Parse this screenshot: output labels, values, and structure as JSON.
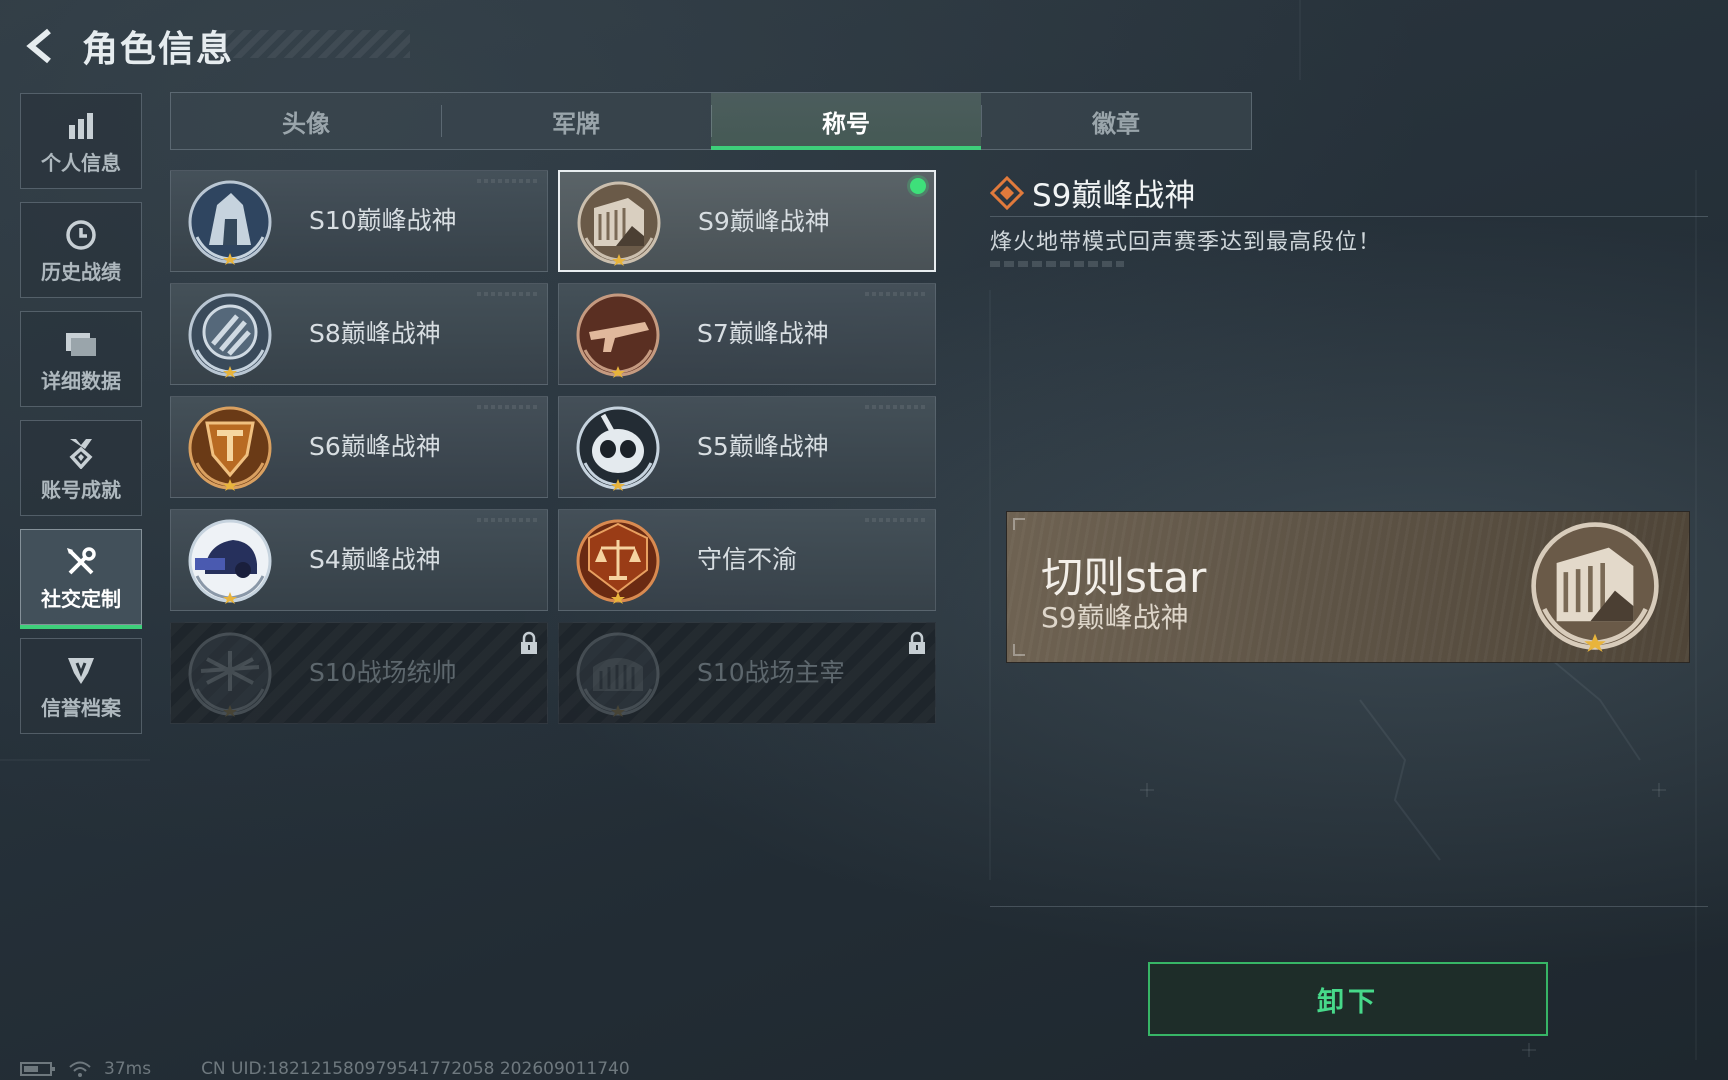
{
  "header": {
    "title": "角色信息"
  },
  "sidebar": {
    "items": [
      {
        "label": "个人信息",
        "icon": "bar-chart-icon"
      },
      {
        "label": "历史战绩",
        "icon": "clock-icon"
      },
      {
        "label": "详细数据",
        "icon": "folder-icon"
      },
      {
        "label": "账号成就",
        "icon": "medal-icon"
      },
      {
        "label": "社交定制",
        "icon": "tools-icon",
        "active": true
      },
      {
        "label": "信誉档案",
        "icon": "shield-icon"
      }
    ]
  },
  "tabs": [
    {
      "label": "头像"
    },
    {
      "label": "军牌"
    },
    {
      "label": "称号",
      "active": true
    },
    {
      "label": "徽章"
    }
  ],
  "titles": [
    {
      "name": "S10巅峰战神",
      "badge": "s10-peak-badge-icon"
    },
    {
      "name": "S9巅峰战神",
      "badge": "s9-peak-badge-icon",
      "selected": true,
      "equipped": true
    },
    {
      "name": "S8巅峰战神",
      "badge": "s8-peak-badge-icon"
    },
    {
      "name": "S7巅峰战神",
      "badge": "s7-peak-badge-icon"
    },
    {
      "name": "S6巅峰战神",
      "badge": "s6-peak-badge-icon"
    },
    {
      "name": "S5巅峰战神",
      "badge": "s5-peak-badge-icon"
    },
    {
      "name": "S4巅峰战神",
      "badge": "s4-peak-badge-icon"
    },
    {
      "name": "守信不渝",
      "badge": "scales-badge-icon"
    },
    {
      "name": "S10战场统帅",
      "badge": "s10-commander-badge-icon",
      "locked": true
    },
    {
      "name": "S10战场主宰",
      "badge": "s10-dominator-badge-icon",
      "locked": true
    }
  ],
  "detail": {
    "title": "S9巅峰战神",
    "description": "烽火地带模式回声赛季达到最高段位！"
  },
  "nameplate": {
    "player_name": "切则star",
    "title": "S9巅峰战神"
  },
  "actions": {
    "unequip_label": "卸下"
  },
  "status": {
    "ping": "37ms",
    "uid": "CN UID:18212158097954177205​8 202609011740"
  },
  "colors": {
    "accent_green": "#3ecf7a",
    "equipped_dot": "#3ee07a",
    "nameplate_bg": "#5e5446"
  }
}
